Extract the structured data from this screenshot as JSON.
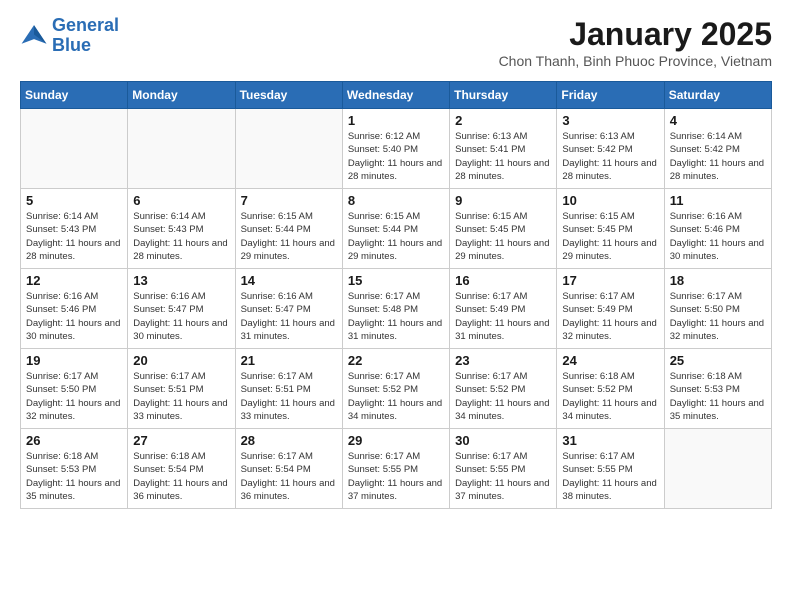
{
  "header": {
    "logo_line1": "General",
    "logo_line2": "Blue",
    "month_title": "January 2025",
    "subtitle": "Chon Thanh, Binh Phuoc Province, Vietnam"
  },
  "days_of_week": [
    "Sunday",
    "Monday",
    "Tuesday",
    "Wednesday",
    "Thursday",
    "Friday",
    "Saturday"
  ],
  "weeks": [
    [
      {
        "day": "",
        "info": ""
      },
      {
        "day": "",
        "info": ""
      },
      {
        "day": "",
        "info": ""
      },
      {
        "day": "1",
        "info": "Sunrise: 6:12 AM\nSunset: 5:40 PM\nDaylight: 11 hours and 28 minutes."
      },
      {
        "day": "2",
        "info": "Sunrise: 6:13 AM\nSunset: 5:41 PM\nDaylight: 11 hours and 28 minutes."
      },
      {
        "day": "3",
        "info": "Sunrise: 6:13 AM\nSunset: 5:42 PM\nDaylight: 11 hours and 28 minutes."
      },
      {
        "day": "4",
        "info": "Sunrise: 6:14 AM\nSunset: 5:42 PM\nDaylight: 11 hours and 28 minutes."
      }
    ],
    [
      {
        "day": "5",
        "info": "Sunrise: 6:14 AM\nSunset: 5:43 PM\nDaylight: 11 hours and 28 minutes."
      },
      {
        "day": "6",
        "info": "Sunrise: 6:14 AM\nSunset: 5:43 PM\nDaylight: 11 hours and 28 minutes."
      },
      {
        "day": "7",
        "info": "Sunrise: 6:15 AM\nSunset: 5:44 PM\nDaylight: 11 hours and 29 minutes."
      },
      {
        "day": "8",
        "info": "Sunrise: 6:15 AM\nSunset: 5:44 PM\nDaylight: 11 hours and 29 minutes."
      },
      {
        "day": "9",
        "info": "Sunrise: 6:15 AM\nSunset: 5:45 PM\nDaylight: 11 hours and 29 minutes."
      },
      {
        "day": "10",
        "info": "Sunrise: 6:15 AM\nSunset: 5:45 PM\nDaylight: 11 hours and 29 minutes."
      },
      {
        "day": "11",
        "info": "Sunrise: 6:16 AM\nSunset: 5:46 PM\nDaylight: 11 hours and 30 minutes."
      }
    ],
    [
      {
        "day": "12",
        "info": "Sunrise: 6:16 AM\nSunset: 5:46 PM\nDaylight: 11 hours and 30 minutes."
      },
      {
        "day": "13",
        "info": "Sunrise: 6:16 AM\nSunset: 5:47 PM\nDaylight: 11 hours and 30 minutes."
      },
      {
        "day": "14",
        "info": "Sunrise: 6:16 AM\nSunset: 5:47 PM\nDaylight: 11 hours and 31 minutes."
      },
      {
        "day": "15",
        "info": "Sunrise: 6:17 AM\nSunset: 5:48 PM\nDaylight: 11 hours and 31 minutes."
      },
      {
        "day": "16",
        "info": "Sunrise: 6:17 AM\nSunset: 5:49 PM\nDaylight: 11 hours and 31 minutes."
      },
      {
        "day": "17",
        "info": "Sunrise: 6:17 AM\nSunset: 5:49 PM\nDaylight: 11 hours and 32 minutes."
      },
      {
        "day": "18",
        "info": "Sunrise: 6:17 AM\nSunset: 5:50 PM\nDaylight: 11 hours and 32 minutes."
      }
    ],
    [
      {
        "day": "19",
        "info": "Sunrise: 6:17 AM\nSunset: 5:50 PM\nDaylight: 11 hours and 32 minutes."
      },
      {
        "day": "20",
        "info": "Sunrise: 6:17 AM\nSunset: 5:51 PM\nDaylight: 11 hours and 33 minutes."
      },
      {
        "day": "21",
        "info": "Sunrise: 6:17 AM\nSunset: 5:51 PM\nDaylight: 11 hours and 33 minutes."
      },
      {
        "day": "22",
        "info": "Sunrise: 6:17 AM\nSunset: 5:52 PM\nDaylight: 11 hours and 34 minutes."
      },
      {
        "day": "23",
        "info": "Sunrise: 6:17 AM\nSunset: 5:52 PM\nDaylight: 11 hours and 34 minutes."
      },
      {
        "day": "24",
        "info": "Sunrise: 6:18 AM\nSunset: 5:52 PM\nDaylight: 11 hours and 34 minutes."
      },
      {
        "day": "25",
        "info": "Sunrise: 6:18 AM\nSunset: 5:53 PM\nDaylight: 11 hours and 35 minutes."
      }
    ],
    [
      {
        "day": "26",
        "info": "Sunrise: 6:18 AM\nSunset: 5:53 PM\nDaylight: 11 hours and 35 minutes."
      },
      {
        "day": "27",
        "info": "Sunrise: 6:18 AM\nSunset: 5:54 PM\nDaylight: 11 hours and 36 minutes."
      },
      {
        "day": "28",
        "info": "Sunrise: 6:17 AM\nSunset: 5:54 PM\nDaylight: 11 hours and 36 minutes."
      },
      {
        "day": "29",
        "info": "Sunrise: 6:17 AM\nSunset: 5:55 PM\nDaylight: 11 hours and 37 minutes."
      },
      {
        "day": "30",
        "info": "Sunrise: 6:17 AM\nSunset: 5:55 PM\nDaylight: 11 hours and 37 minutes."
      },
      {
        "day": "31",
        "info": "Sunrise: 6:17 AM\nSunset: 5:55 PM\nDaylight: 11 hours and 38 minutes."
      },
      {
        "day": "",
        "info": ""
      }
    ]
  ]
}
